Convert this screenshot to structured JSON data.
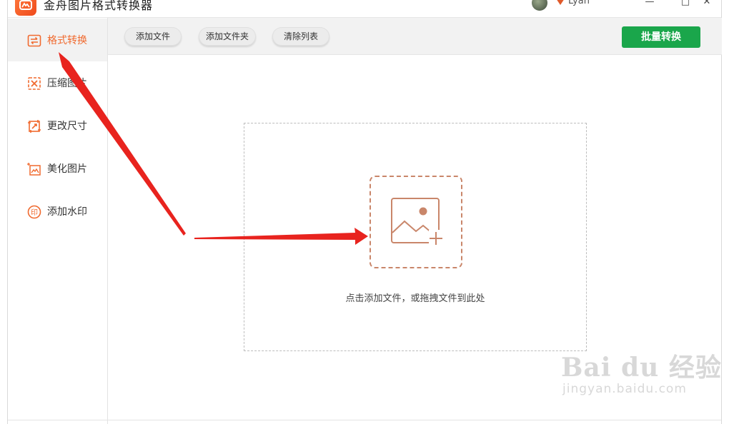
{
  "titlebar": {
    "title": "金舟图片格式转换器",
    "user_name": "Lyan",
    "controls": [
      "—",
      "□",
      "✕"
    ]
  },
  "sidebar": {
    "items": [
      {
        "label": "格式转换",
        "icon": "convert-icon",
        "active": true
      },
      {
        "label": "压缩图片",
        "icon": "compress-icon",
        "active": false
      },
      {
        "label": "更改尺寸",
        "icon": "resize-icon",
        "active": false
      },
      {
        "label": "美化图片",
        "icon": "beautify-icon",
        "active": false
      },
      {
        "label": "添加水印",
        "icon": "watermark-icon",
        "active": false
      }
    ]
  },
  "toolbar": {
    "add_file": "添加文件",
    "add_folder": "添加文件夹",
    "clear_list": "清除列表",
    "batch_convert": "批量转换"
  },
  "dropzone": {
    "hint": "点击添加文件，或拖拽文件到此处"
  },
  "watermark": {
    "brand": "Bai du 经验",
    "sub": "jingyan.baidu.com"
  },
  "colors": {
    "accent": "#f06a2f",
    "primary_button": "#1aa64b",
    "icon_brown": "#c9866a",
    "arrow": "#e8231e"
  }
}
